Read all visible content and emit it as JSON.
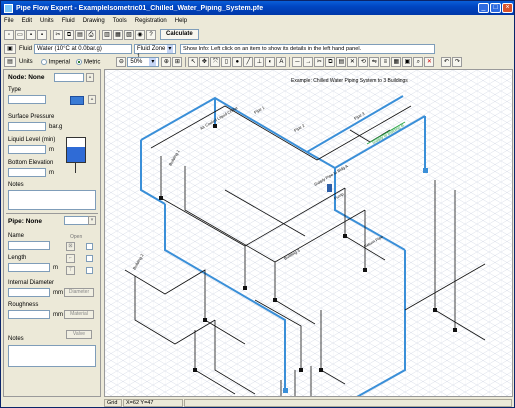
{
  "window": {
    "title": "Pipe Flow Expert - ExampleIsometric01_Chilled_Water_Piping_System.pfe"
  },
  "menu": [
    "File",
    "Edit",
    "Units",
    "Fluid",
    "Drawing",
    "Tools",
    "Registration",
    "Help"
  ],
  "toolbar": {
    "calculate_label": "Calculate",
    "zoom_value": "50%"
  },
  "fluidbar": {
    "fluid_label": "Fluid",
    "fluid_value": "Water (10°C at 0.0bar.g)",
    "fluid_zone": "Fluid Zone 1",
    "info": "Show Info: Left click on an item to show its details in the left hand panel."
  },
  "units": {
    "label": "Units",
    "imperial": "Imperial",
    "metric": "Metric"
  },
  "node_panel": {
    "heading": "Node: None",
    "type_label": "Type",
    "surface_pressure_label": "Surface Pressure",
    "surface_pressure_unit": "bar.g",
    "liquid_level_label": "Liquid Level (min)",
    "liquid_level_unit": "m",
    "bottom_elevation_label": "Bottom Elevation",
    "bottom_elevation_unit": "m",
    "notes_label": "Notes"
  },
  "pipe_panel": {
    "heading": "Pipe: None",
    "name_label": "Name",
    "length_label": "Length",
    "length_unit": "m",
    "internal_diameter_label": "Internal Diameter",
    "internal_diameter_unit": "mm",
    "roughness_label": "Roughness",
    "roughness_unit": "mm",
    "notes_label": "Notes",
    "open_label": "Open",
    "closed_label": "Closed",
    "material_btn": "Material",
    "diameter_btn": "Diameter",
    "valve_btn": "Valve"
  },
  "diagram": {
    "title": "Example: Chilled Water Piping System to 3 Buildings",
    "labels": [
      "Air Cooled Liquid Chiller",
      "Pipe 1",
      "Pipe 2",
      "Pipe 3",
      "Supply Pipe to Bldg A",
      "Pump",
      "Building 1",
      "Building 2",
      "Building 3",
      "Return Pipe"
    ],
    "supply_note": "Supply to Building B"
  },
  "status": {
    "grid": "Grid",
    "coords": "X=62  Y=47"
  }
}
